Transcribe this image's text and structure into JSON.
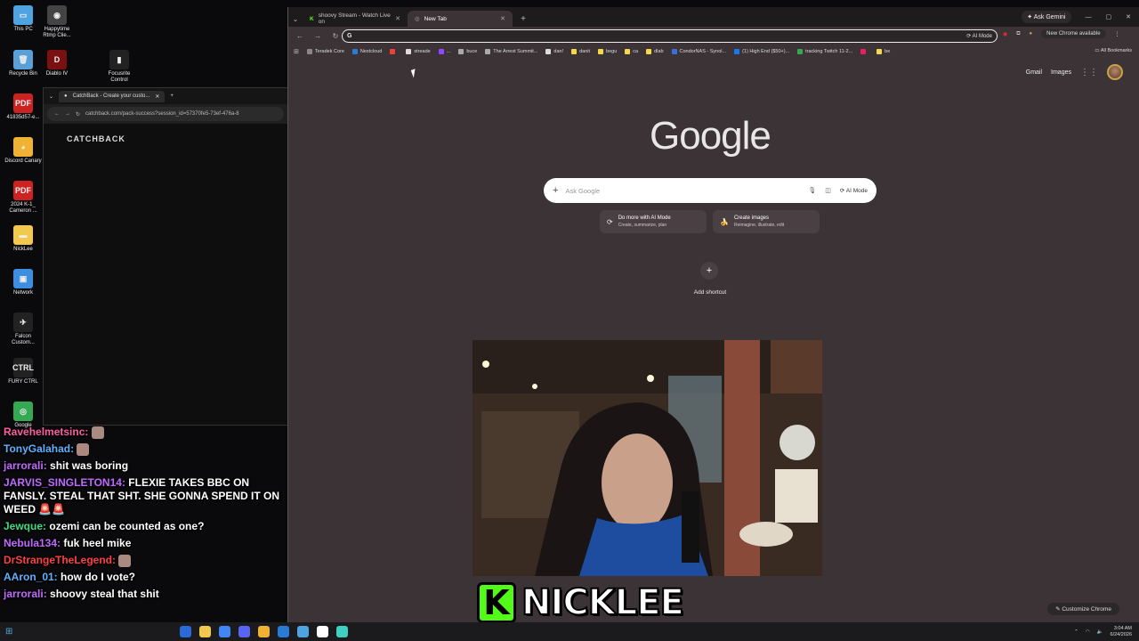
{
  "desktop": {
    "icons": [
      {
        "label": "This PC",
        "color": "#4fa3e0",
        "glyph": "▭"
      },
      {
        "label": "Happytime Rtmp Clie...",
        "color": "#444",
        "glyph": "◉"
      },
      {
        "label": "Recycle Bin",
        "color": "#5aa0d8",
        "glyph": "🗑"
      },
      {
        "label": "Diablo IV",
        "color": "#7a1010",
        "glyph": "D"
      },
      {
        "label": "Focusrite Control",
        "color": "#222",
        "glyph": "▮"
      },
      {
        "label": "41835d57-e...",
        "color": "#c22",
        "glyph": "PDF"
      },
      {
        "label": "Discord Canary",
        "color": "#f0b232",
        "glyph": "◕"
      },
      {
        "label": "2024 K-1_ Cameron ...",
        "color": "#c22",
        "glyph": "PDF"
      },
      {
        "label": "NickLee",
        "color": "#f2c94c",
        "glyph": "▬"
      },
      {
        "label": "Network",
        "color": "#3d8ee0",
        "glyph": "▣"
      },
      {
        "label": "Falcon Custom...",
        "color": "#222",
        "glyph": "✈"
      },
      {
        "label": "FURY CTRL",
        "color": "#222",
        "glyph": "CTRL"
      },
      {
        "label": "Google",
        "color": "#34a853",
        "glyph": "◎"
      }
    ]
  },
  "catchback": {
    "tab_title": "CatchBack - Create your custo...",
    "url": "catchback.com/pack-success?session_id=57370fe5-73ef-476a-8",
    "logo": "CATCHBACK"
  },
  "chrome": {
    "tabs": [
      {
        "title": "shoovy Stream - Watch Live on",
        "active": false,
        "icon_color": "#53fc18"
      },
      {
        "title": "New Tab",
        "active": true,
        "icon_color": "#aaa"
      }
    ],
    "ask_gemini": "Ask Gemini",
    "omnibox": {
      "prefix": "G",
      "ai_mode": "AI Mode"
    },
    "update_chip": "New Chrome available",
    "bookmarks": [
      {
        "label": "Teradek Core",
        "color": "#888"
      },
      {
        "label": "Nextcloud",
        "color": "#2a7bd6"
      },
      {
        "label": "",
        "color": "#ea4335"
      },
      {
        "label": "streade",
        "color": "#ddd"
      },
      {
        "label": "...",
        "color": "#9146ff"
      },
      {
        "label": "buce",
        "color": "#aaa"
      },
      {
        "label": "The Arrest Summit...",
        "color": "#aaa"
      },
      {
        "label": "dan!",
        "color": "#ddd"
      },
      {
        "label": "danit",
        "color": "#f5d94a"
      },
      {
        "label": "begu",
        "color": "#f5d94a"
      },
      {
        "label": "ca",
        "color": "#f5d94a"
      },
      {
        "label": "dlab",
        "color": "#f5d94a"
      },
      {
        "label": "CondorNAS - Synol...",
        "color": "#3a6fd8"
      },
      {
        "label": "(1) High End ($50+)...",
        "color": "#1877f2"
      },
      {
        "label": "tracking Twitch 11-2...",
        "color": "#34a853"
      },
      {
        "label": "",
        "color": "#e91e63"
      },
      {
        "label": "be",
        "color": "#f5d94a"
      }
    ],
    "all_bookmarks": "All Bookmarks"
  },
  "ntp": {
    "gmail": "Gmail",
    "images": "Images",
    "logo": "Google",
    "search_placeholder": "Ask Google",
    "search_ai_mode": "AI Mode",
    "suggestions": [
      {
        "title": "Do more with AI Mode",
        "subtitle": "Create, summarize, plan",
        "icon": "⟳"
      },
      {
        "title": "Create images",
        "subtitle": "Reimagine, illustrate, edit",
        "icon": "🍌"
      }
    ],
    "add_shortcut": "Add shortcut",
    "customize": "Customize Chrome"
  },
  "overlay": {
    "channel_name": "NICKLEE",
    "kick_letter": "K"
  },
  "chat": [
    {
      "user": "Ravehelmetsinc:",
      "color": "#ff5fa2",
      "message": "",
      "emote": true
    },
    {
      "user": "TonyGalahad:",
      "color": "#5fb0ff",
      "message": "",
      "emote": true
    },
    {
      "user": "jarrorali:",
      "color": "#c06bff",
      "message": "shit was boring",
      "emote": false
    },
    {
      "user": "JARVIS_SINGLETON14:",
      "color": "#c06bff",
      "message": "FLEXIE TAKES BBC ON FANSLY. STEAL THAT SHT. SHE GONNA SPEND IT ON WEED 🚨🚨",
      "emote": false
    },
    {
      "user": "Jewque:",
      "color": "#3ddc84",
      "message": "ozemi can be counted as one?",
      "emote": false
    },
    {
      "user": "Nebula134:",
      "color": "#c06bff",
      "message": "fuk heel mike",
      "emote": false
    },
    {
      "user": "DrStrangeTheLegend:",
      "color": "#ff4040",
      "message": "",
      "emote": true
    },
    {
      "user": "AAron_01:",
      "color": "#5fb0ff",
      "message": "how do I vote?",
      "emote": false
    },
    {
      "user": "jarrorali:",
      "color": "#c06bff",
      "message": "shoovy steal that shit",
      "emote": false
    }
  ],
  "taskbar": {
    "apps": [
      "#2a6ad8",
      "#f2c94c",
      "#4285f4",
      "#5865f2",
      "#f0b232",
      "#2a7bd6",
      "#4fa3e0",
      "#ffffff",
      "#3fd0c0"
    ],
    "time": "3:04 AM",
    "date": "6/24/2026"
  }
}
